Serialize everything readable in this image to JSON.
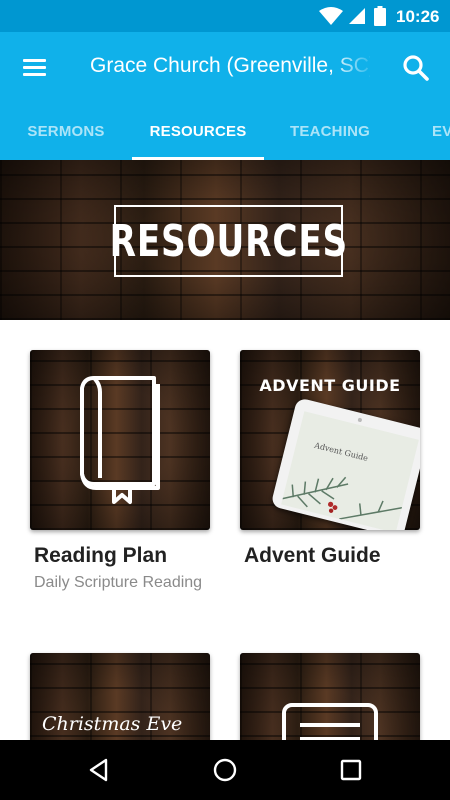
{
  "status_bar": {
    "time": "10:26",
    "icons": [
      "wifi-icon",
      "signal-icon",
      "battery-icon"
    ]
  },
  "app_bar": {
    "title": "Grace Church (Greenville, SC)",
    "menu_icon": "hamburger-menu-icon",
    "search_icon": "search-icon",
    "background": "#10b1ea",
    "status_background": "#0097d1"
  },
  "tabs": [
    {
      "label": "SERMONS",
      "active": false
    },
    {
      "label": "RESOURCES",
      "active": true
    },
    {
      "label": "TEACHING",
      "active": false
    },
    {
      "label": "EVENTS",
      "active": false
    }
  ],
  "banner": {
    "title": "RESOURCES"
  },
  "cards": [
    {
      "title": "Reading Plan",
      "subtitle": "Daily Scripture Reading",
      "image_icon": "book-icon"
    },
    {
      "title": "Advent Guide",
      "subtitle": "",
      "image_heading": "ADVENT GUIDE",
      "tablet_text": "Advent Guide"
    },
    {
      "title": "",
      "subtitle": "",
      "image_text": "Christmas Eve"
    },
    {
      "title": "",
      "subtitle": "",
      "image_icon": "document-icon"
    }
  ],
  "nav_bar": {
    "icons": [
      "back-icon",
      "home-icon",
      "recent-apps-icon"
    ]
  }
}
